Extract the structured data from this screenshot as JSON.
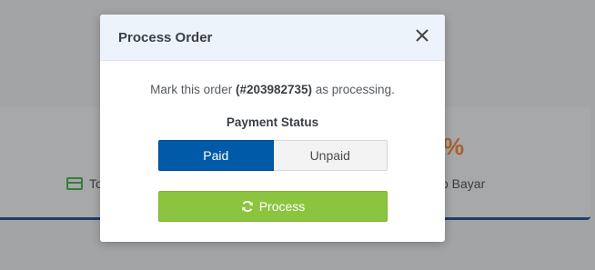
{
  "background": {
    "left_stat_label": "To",
    "right_stat_value": "%",
    "right_stat_label": "o Bayar"
  },
  "modal": {
    "title": "Process Order",
    "message_prefix": "Mark this order ",
    "order_ref": "(#203982735)",
    "message_suffix": " as processing.",
    "payment_status_label": "Payment Status",
    "options": {
      "paid": "Paid",
      "unpaid": "Unpaid"
    },
    "selected": "Paid",
    "process_label": "Process"
  },
  "colors": {
    "primary": "#005aa7",
    "success": "#8bc540",
    "header_bg": "#edf3fb"
  },
  "icons": {
    "close": "close-icon",
    "process": "refresh-icon",
    "card": "credit-card-icon"
  }
}
